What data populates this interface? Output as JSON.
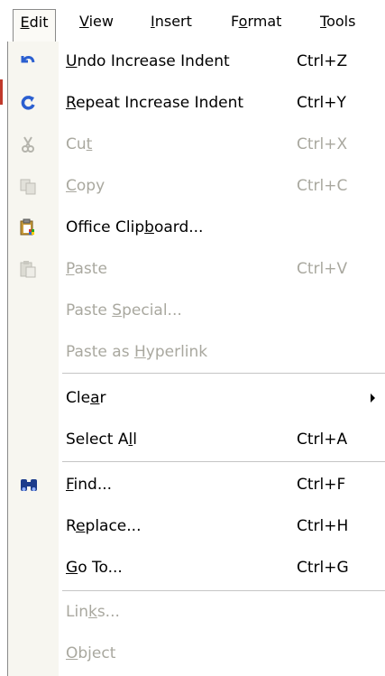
{
  "menubar": {
    "edit": {
      "pre": "",
      "u": "E",
      "post": "dit"
    },
    "view": {
      "pre": "",
      "u": "V",
      "post": "iew"
    },
    "insert": {
      "pre": "",
      "u": "I",
      "post": "nsert"
    },
    "format": {
      "pre": "F",
      "u": "o",
      "post": "rmat"
    },
    "tools": {
      "pre": "",
      "u": "T",
      "post": "ools"
    }
  },
  "items": {
    "undo": {
      "pre": "",
      "u": "U",
      "post": "ndo Increase Indent",
      "shortcut": "Ctrl+Z",
      "icon": "undo-icon"
    },
    "repeat": {
      "pre": "",
      "u": "R",
      "post": "epeat Increase Indent",
      "shortcut": "Ctrl+Y",
      "icon": "repeat-icon"
    },
    "cut": {
      "pre": "Cu",
      "u": "t",
      "post": "",
      "shortcut": "Ctrl+X",
      "icon": "scissors-icon"
    },
    "copy": {
      "pre": "",
      "u": "C",
      "post": "opy",
      "shortcut": "Ctrl+C",
      "icon": "copy-icon"
    },
    "office_clipboard": {
      "pre": "Office Clip",
      "u": "b",
      "post": "oard...",
      "shortcut": "",
      "icon": "clipboard-icon"
    },
    "paste": {
      "pre": "",
      "u": "P",
      "post": "aste",
      "shortcut": "Ctrl+V",
      "icon": "paste-icon"
    },
    "paste_special": {
      "pre": "Paste ",
      "u": "S",
      "post": "pecial...",
      "shortcut": ""
    },
    "paste_hyperlink": {
      "pre": "Paste as ",
      "u": "H",
      "post": "yperlink",
      "shortcut": ""
    },
    "clear": {
      "pre": "Cle",
      "u": "a",
      "post": "r",
      "shortcut": ""
    },
    "select_all": {
      "pre": "Select A",
      "u": "l",
      "post": "l",
      "shortcut": "Ctrl+A"
    },
    "find": {
      "pre": "",
      "u": "F",
      "post": "ind...",
      "shortcut": "Ctrl+F",
      "icon": "binoculars-icon"
    },
    "replace": {
      "pre": "R",
      "u": "e",
      "post": "place...",
      "shortcut": "Ctrl+H"
    },
    "goto": {
      "pre": "",
      "u": "G",
      "post": "o To...",
      "shortcut": "Ctrl+G"
    },
    "links": {
      "pre": "Lin",
      "u": "k",
      "post": "s...",
      "shortcut": ""
    },
    "object": {
      "pre": "",
      "u": "O",
      "post": "bject",
      "shortcut": ""
    }
  },
  "colors": {
    "gutter": "#f7f6f0",
    "disabled_text": "#a9a89f",
    "undo_blue": "#2b5fd0"
  }
}
